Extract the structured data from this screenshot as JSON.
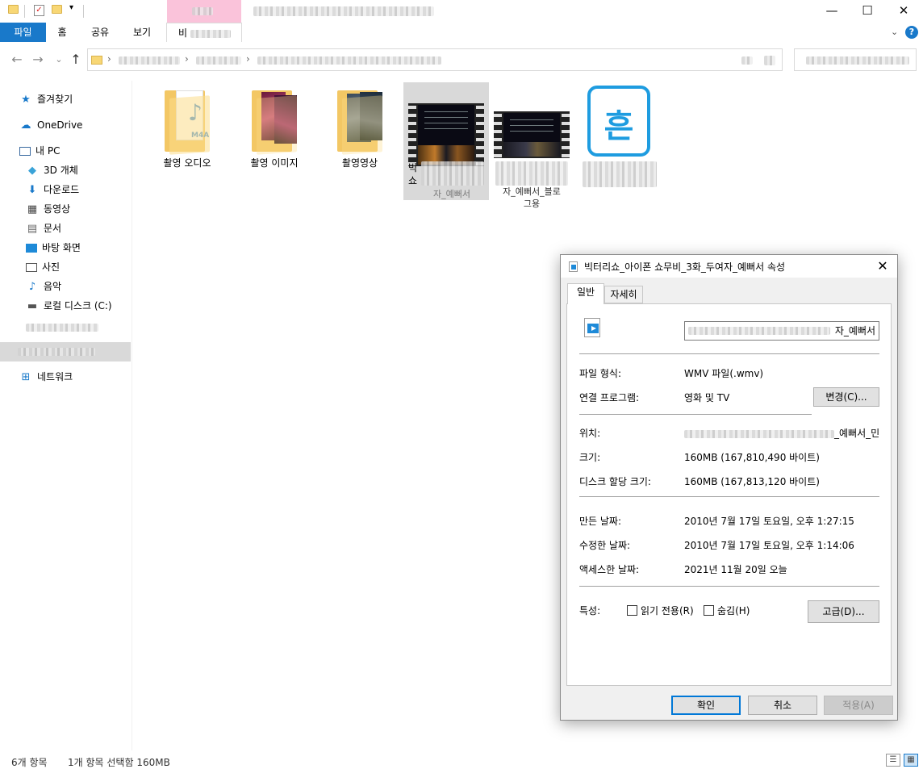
{
  "ribbon": {
    "tabs": [
      "파일",
      "홈",
      "공유",
      "보기",
      "비"
    ],
    "help": "?"
  },
  "window_controls": {
    "minimize": "—",
    "maximize": "☐",
    "close": "✕"
  },
  "nav_buttons": {
    "back": "←",
    "forward": "→",
    "recent": "⌄",
    "up": "↑",
    "breadcrumb_sep": "›"
  },
  "sidebar": {
    "items": [
      {
        "label": "즐겨찾기",
        "icon": "star-icon"
      },
      {
        "label": "OneDrive",
        "icon": "cloud-icon"
      },
      {
        "label": "내 PC",
        "icon": "computer-icon"
      },
      {
        "label": "3D 개체",
        "icon": "cube-icon"
      },
      {
        "label": "다운로드",
        "icon": "download-icon"
      },
      {
        "label": "동영상",
        "icon": "video-icon"
      },
      {
        "label": "문서",
        "icon": "document-icon"
      },
      {
        "label": "바탕 화면",
        "icon": "desktop-icon"
      },
      {
        "label": "사진",
        "icon": "picture-icon"
      },
      {
        "label": "음악",
        "icon": "music-icon"
      },
      {
        "label": "로컬 디스크 (C:)",
        "icon": "drive-icon"
      },
      {
        "label": "네트워크",
        "icon": "network-icon"
      }
    ]
  },
  "files": [
    {
      "name": "촬영 오디오",
      "kind": "folder-audio"
    },
    {
      "name": "촬영 이미지",
      "kind": "folder-images"
    },
    {
      "name": "촬영영상",
      "kind": "folder-video"
    },
    {
      "name_visible_part": "빅\n쇼",
      "name_tail": "자_예뻐서",
      "kind": "video-selected"
    },
    {
      "name_tail": "자_예뻐서_블로\n그용",
      "kind": "video"
    },
    {
      "kind": "hangul-doc"
    }
  ],
  "hangul_glyph": "흔",
  "status_bar": {
    "item_count": "6개 항목",
    "selection": "1개 항목 선택함 160MB"
  },
  "properties": {
    "title": "빅터리쇼_아이폰 쇼무비_3화_두여자_예뻐서 속성",
    "close": "✕",
    "tabs": [
      "일반",
      "자세히"
    ],
    "filename_visible": "자_예뻐서",
    "file_type_label": "파일 형식:",
    "file_type_value": "WMV 파일(.wmv)",
    "opens_with_label": "연결 프로그램:",
    "opens_with_value": "영화 및 TV",
    "change_button": "변경(C)...",
    "location_label": "위치:",
    "location_value_visible": "_예뻐서_민",
    "size_label": "크기:",
    "size_value": "160MB (167,810,490 바이트)",
    "disk_size_label": "디스크 할당 크기:",
    "disk_size_value": "160MB (167,813,120 바이트)",
    "created_label": "만든 날짜:",
    "created_value": "2010년 7월 17일 토요일, 오후 1:27:15",
    "modified_label": "수정한 날짜:",
    "modified_value": "2010년 7월 17일 토요일, 오후 1:14:06",
    "accessed_label": "액세스한 날짜:",
    "accessed_value": "2021년 11월 20일 오늘",
    "attributes_label": "특성:",
    "readonly_label": "읽기 전용(R)",
    "hidden_label": "숨김(H)",
    "advanced_button": "고급(D)...",
    "ok_button": "확인",
    "cancel_button": "취소",
    "apply_button": "적용(A)"
  },
  "colors": {
    "accent": "#1979ca",
    "folder": "#f8d775",
    "selection": "#d9d9d9",
    "primary_button_border": "#0078d7"
  }
}
